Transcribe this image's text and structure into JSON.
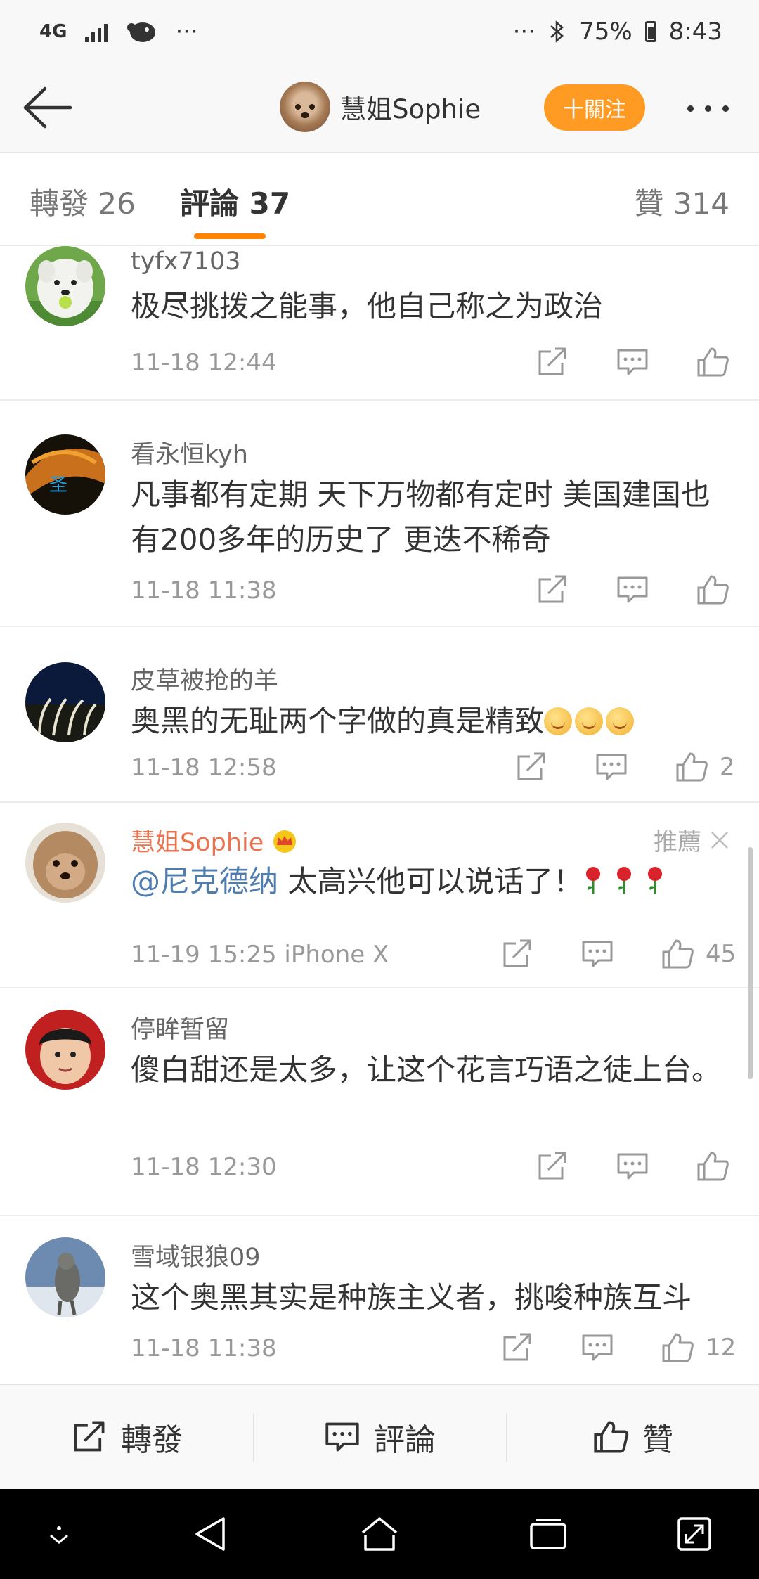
{
  "status_bar": {
    "network": "4G",
    "ellipsis_left": "···",
    "ellipsis_right": "···",
    "battery": "75%",
    "time": "8:43"
  },
  "header": {
    "username": "慧姐Sophie",
    "follow_label": "十關注"
  },
  "tabs": [
    {
      "label": "轉發 26"
    },
    {
      "label": "評論 37"
    },
    {
      "label": "贊 314"
    }
  ],
  "comments": [
    {
      "user": "tyfx7103",
      "text": "极尽挑拨之能事，他自己称之为政治",
      "time": "11-18 12:44",
      "likes": ""
    },
    {
      "user": "看永恒kyh",
      "text": "凡事都有定期 天下万物都有定时 美国建国也有200多年的历史了 更迭不稀奇",
      "time": "11-18 11:38",
      "likes": ""
    },
    {
      "user": "皮草被抢的羊",
      "text": "奥黑的无耻两个字做的真是精致",
      "time": "11-18 12:58",
      "likes": "2"
    },
    {
      "user": "慧姐Sophie",
      "mention": "@尼克德纳",
      "text": " 太高兴他可以说话了！",
      "time": "11-19 15:25",
      "device": "iPhone X",
      "likes": "45",
      "recommend": "推薦"
    },
    {
      "user": "停眸暂留",
      "text": "傻白甜还是太多，让这个花言巧语之徒上台。",
      "time": "11-18 12:30",
      "likes": ""
    },
    {
      "user": "雪域银狼09",
      "text": "这个奥黑其实是种族主义者，挑唆种族互斗",
      "time": "11-18 11:38",
      "likes": "12"
    }
  ],
  "bottom_bar": {
    "repost": "轉發",
    "comment": "評論",
    "like": "贊"
  },
  "colors": {
    "accent": "#ff8200",
    "follow_button": "#ff9a22",
    "owner_name": "#eb7350",
    "mention": "#507daf"
  }
}
